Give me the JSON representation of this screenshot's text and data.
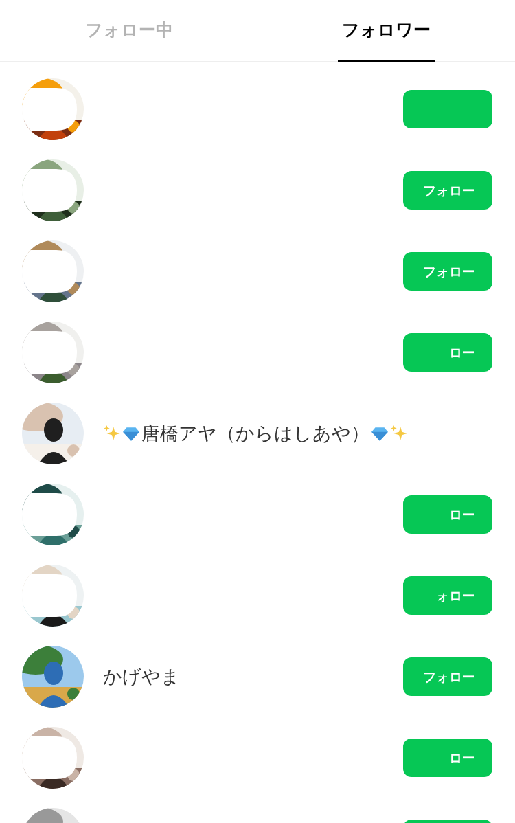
{
  "tabs": [
    {
      "label": "フォロー中",
      "selected": false
    },
    {
      "label": "フォロワー",
      "selected": true
    }
  ],
  "rows": [
    {
      "redacted": true,
      "button": {}
    },
    {
      "redacted": true,
      "button": {
        "label": "フォロー"
      }
    },
    {
      "redacted": true,
      "button": {
        "label": "フォロー"
      }
    },
    {
      "redacted": true,
      "button": {
        "label": "ロー"
      }
    },
    {
      "redacted": false,
      "name": "唐橋アヤ（からはしあや）",
      "decorated": true
    },
    {
      "redacted": true,
      "button": {
        "label": "ロー"
      }
    },
    {
      "redacted": true,
      "button": {
        "label": "ォロー"
      }
    },
    {
      "redacted": false,
      "name": "かげやま",
      "button": {
        "label": "フォロー"
      }
    },
    {
      "redacted": true,
      "button": {
        "label": "ロー"
      }
    },
    {
      "redacted": false,
      "button": {}
    }
  ]
}
